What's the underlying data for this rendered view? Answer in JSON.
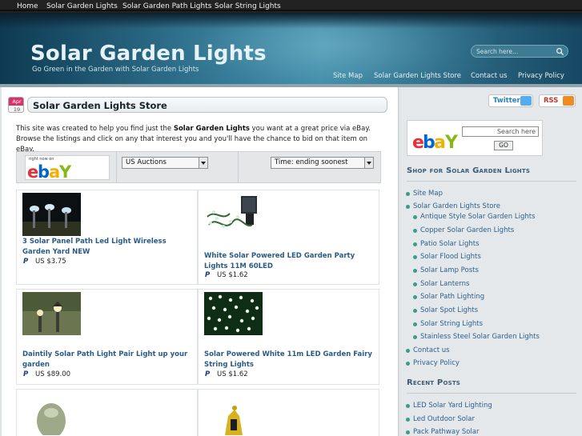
{
  "top_nav": [
    "Home",
    "Solar Garden Lights",
    "Solar Garden Path Lights",
    "Solar String Lights"
  ],
  "header": {
    "title": "Solar Garden Lights",
    "tagline": "Go Green in the Garden with Solar Garden Lights",
    "search_placeholder": "Search here...",
    "nav": [
      "Site Map",
      "Solar Garden Lights Store",
      "Contact us",
      "Privacy Policy"
    ]
  },
  "post": {
    "date_month": "Apr",
    "date_day": "19",
    "title": "Solar Garden Lights Store",
    "intro_before": "This site was created to help you find just the ",
    "intro_bold": "Solar Garden Lights",
    "intro_after": " you want at a great price via eBay. Browse the listings and click on any that interest you and you'll have the chance to bid on that item on eBay."
  },
  "filters": {
    "right_now_on": "right now on",
    "auction_type": "US Auctions",
    "sort": "Time: ending soonest"
  },
  "listings": [
    {
      "title": "3 Solar Panel Path Led Light Wireless Garden Yard NEW",
      "price": "US $3.75"
    },
    {
      "title": "White Solar Powered LED Garden Party Lights 11M 60LED",
      "price": "US $1.62"
    },
    {
      "title": "Daintily Solar Path Light Pair Light up your garden",
      "price": "US $89.00"
    },
    {
      "title": "Solar Powered White 11m LED Garden Fairy String Lights",
      "price": "US $1.62"
    }
  ],
  "sidebar": {
    "twitter": "Twitter",
    "rss": "RSS",
    "ebay_search_placeholder": "Search here",
    "go": "GO",
    "shop_heading": "Shop for Solar Garden Lights",
    "shop_items": [
      "Site Map",
      "Solar Garden Lights Store",
      "Antique Style Solar Garden Lights",
      "Copper Solar Garden Lights",
      "Patio Solar Lights",
      "Solar Flood Lights",
      "Solar Lamp Posts",
      "Solar Lanterns",
      "Solar Path Lighting",
      "Solar Spot Lights",
      "Solar String Lights",
      "Stainless Steel Solar Garden Lights",
      "Contact us",
      "Privacy Policy"
    ],
    "recent_heading": "Recent Posts",
    "recent_items": [
      "LED Solar Yard Lighting",
      "Led Outdoor Solar",
      "Pack Pathway Solar"
    ]
  },
  "colors": {
    "header_dark": "#0e3a52",
    "header_light": "#3e8ba6",
    "link": "#2a5b85",
    "sidebar_heading": "#3b5b73",
    "bullet": "#3f9a88",
    "date_badge": "#d5336b"
  }
}
